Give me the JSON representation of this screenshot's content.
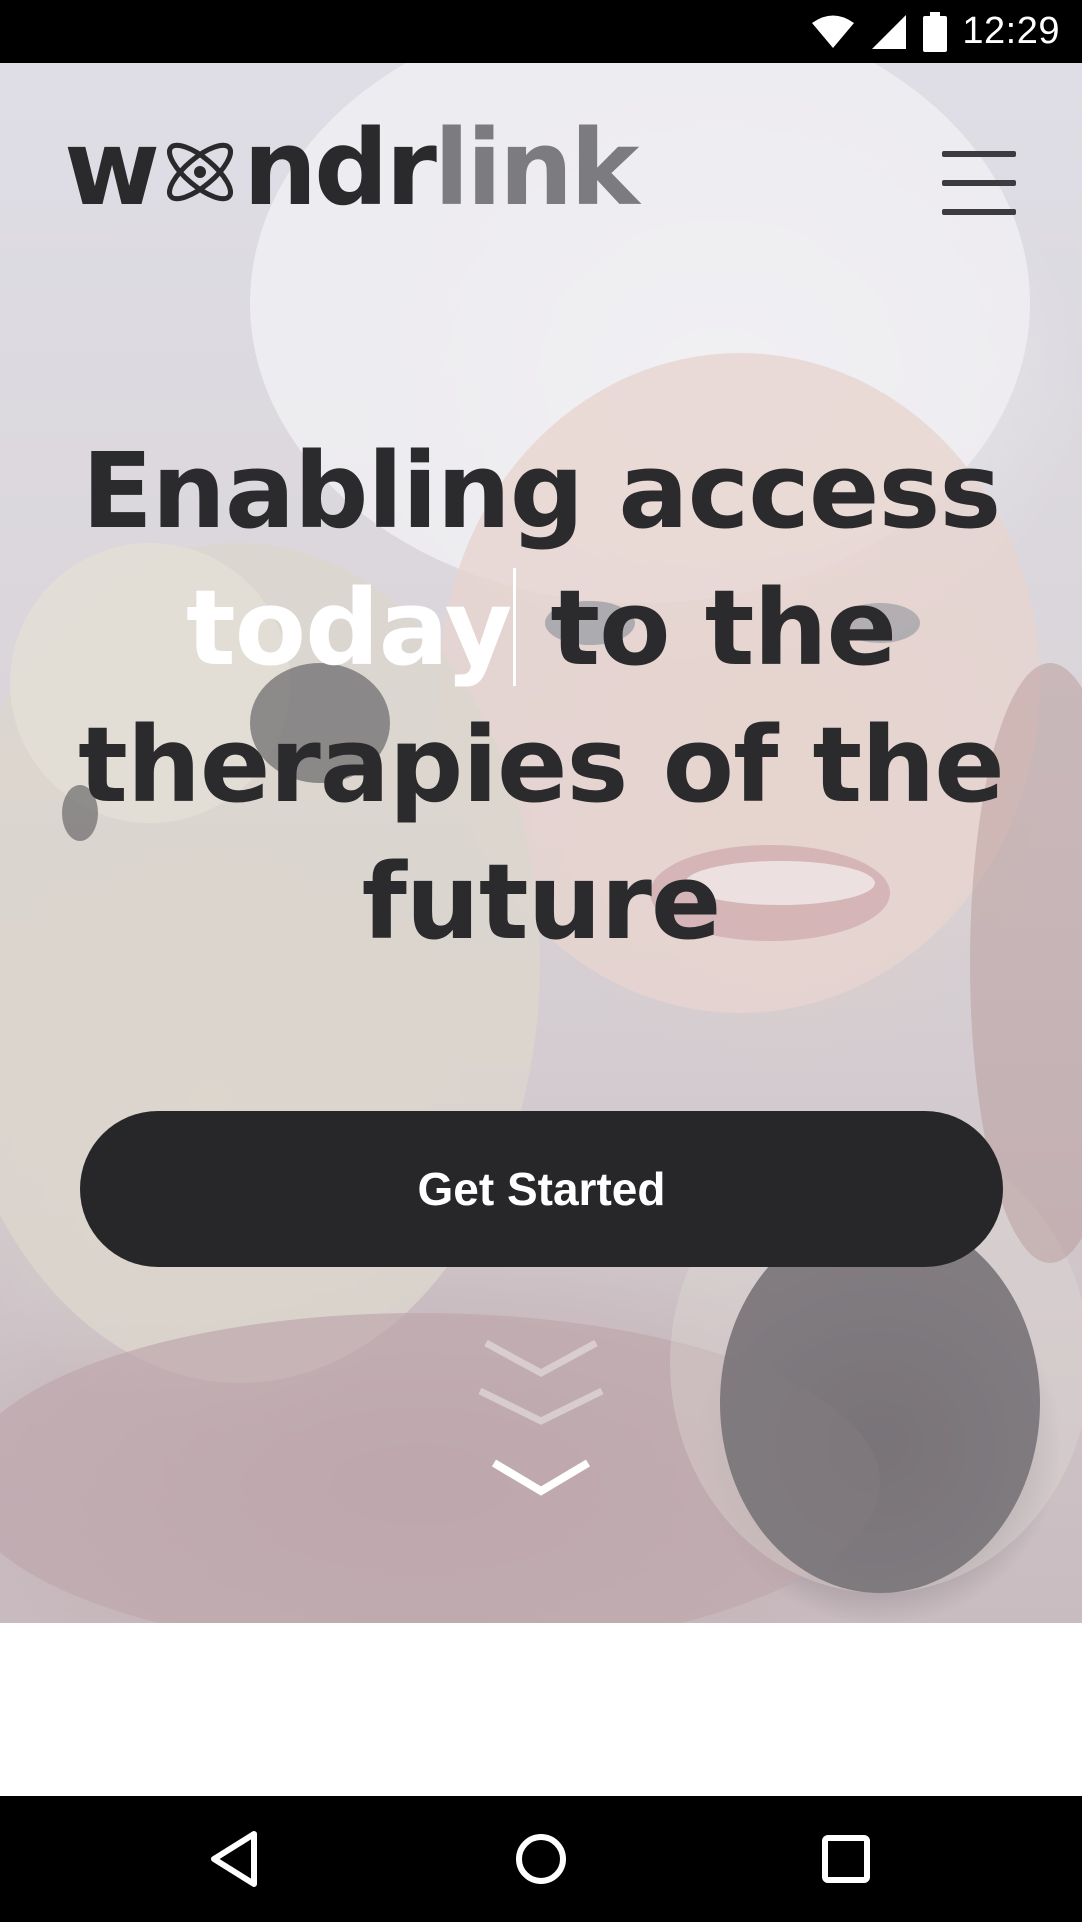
{
  "status_bar": {
    "time": "12:29",
    "icons": [
      "wifi-icon",
      "cell-signal-icon",
      "battery-icon"
    ]
  },
  "header": {
    "logo_prefix": "w",
    "logo_suffix_dark": "ndr",
    "logo_suffix_light": "link",
    "menu_icon": "hamburger-menu-icon"
  },
  "hero": {
    "headline_before": "Enabling access",
    "rotating_word": "today",
    "headline_after": "to the therapies of the future",
    "cta_label": "Get Started",
    "scroll_icon": "chevron-down-icon"
  },
  "navigation_bar": {
    "icons": [
      "back-icon",
      "home-icon",
      "recents-icon"
    ]
  },
  "colors": {
    "text_dark": "#2b2b2d",
    "logo_light": "#7c7b80",
    "cta_background": "#27272a",
    "cta_text": "#ffffff",
    "rotating_word": "#ffffff"
  }
}
